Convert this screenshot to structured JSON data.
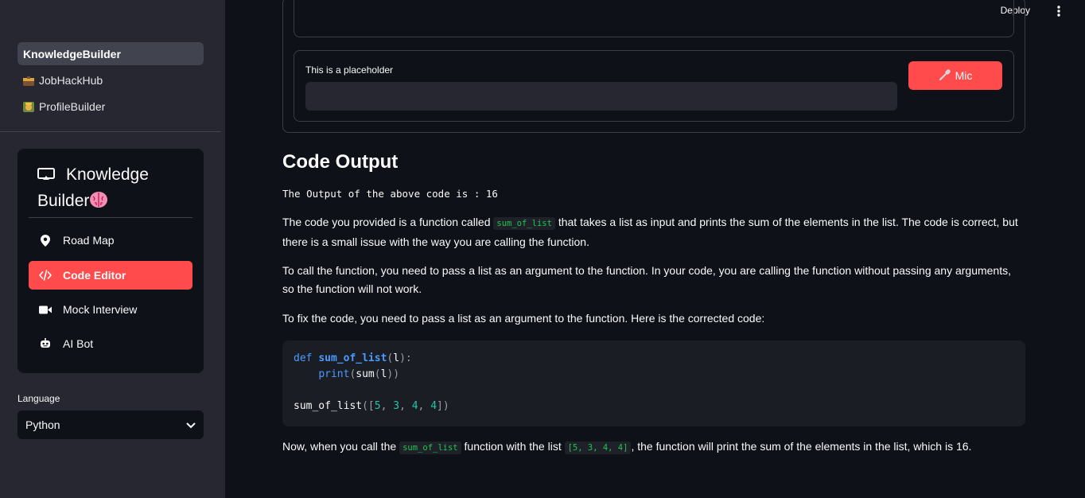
{
  "header": {
    "deploy_label": "Deploy"
  },
  "pages": [
    {
      "label": "KnowledgeBuilder",
      "active": true
    },
    {
      "label": "JobHackHub",
      "icon": "briefcase-emoji-icon",
      "color": "#d9a441"
    },
    {
      "label": "ProfileBuilder",
      "icon": "construction-worker-emoji-icon",
      "color": "#c9a23a"
    }
  ],
  "nav": {
    "title_line1": "Knowledge",
    "title_line2": "Builder",
    "items": [
      {
        "label": "Road Map",
        "icon": "map-pin-icon"
      },
      {
        "label": "Code Editor",
        "icon": "code-icon",
        "active": true
      },
      {
        "label": "Mock Interview",
        "icon": "video-camera-icon"
      },
      {
        "label": "AI Bot",
        "icon": "robot-icon"
      }
    ]
  },
  "language": {
    "label": "Language",
    "value": "Python"
  },
  "input": {
    "label": "This is a placeholder",
    "mic_label": "Mic"
  },
  "content": {
    "heading": "Code Output",
    "output_line": "The Output of the above code is : 16",
    "p1_a": "The code you provided is a function called ",
    "p1_code": "sum_of_list",
    "p1_b": " that takes a list as input and prints the sum of the elements in the list. The code is correct, but there is a small issue with the way you are calling the function.",
    "p2": "To call the function, you need to pass a list as an argument to the function. In your code, you are calling the function without passing any arguments, so the function will not work.",
    "p3": "To fix the code, you need to pass a list as an argument to the function. Here is the corrected code:",
    "code": {
      "kw_def": "def",
      "fn_name": "sum_of_list",
      "param": "l",
      "print": "print",
      "sum": "sum",
      "call_name": "sum_of_list",
      "list_values": [
        "5",
        "3",
        "4",
        "4"
      ]
    },
    "p4_a": "Now, when you call the ",
    "p4_code1": "sum_of_list",
    "p4_b": " function with the list ",
    "p4_code2": "[5, 3, 4, 4]",
    "p4_c": ", the function will print the sum of the elements in the list, which is 16."
  },
  "colors": {
    "accent": "#ff4b4b",
    "sidebar_bg": "#262730",
    "main_bg": "#0e1117",
    "inline_code": "#21c354"
  }
}
